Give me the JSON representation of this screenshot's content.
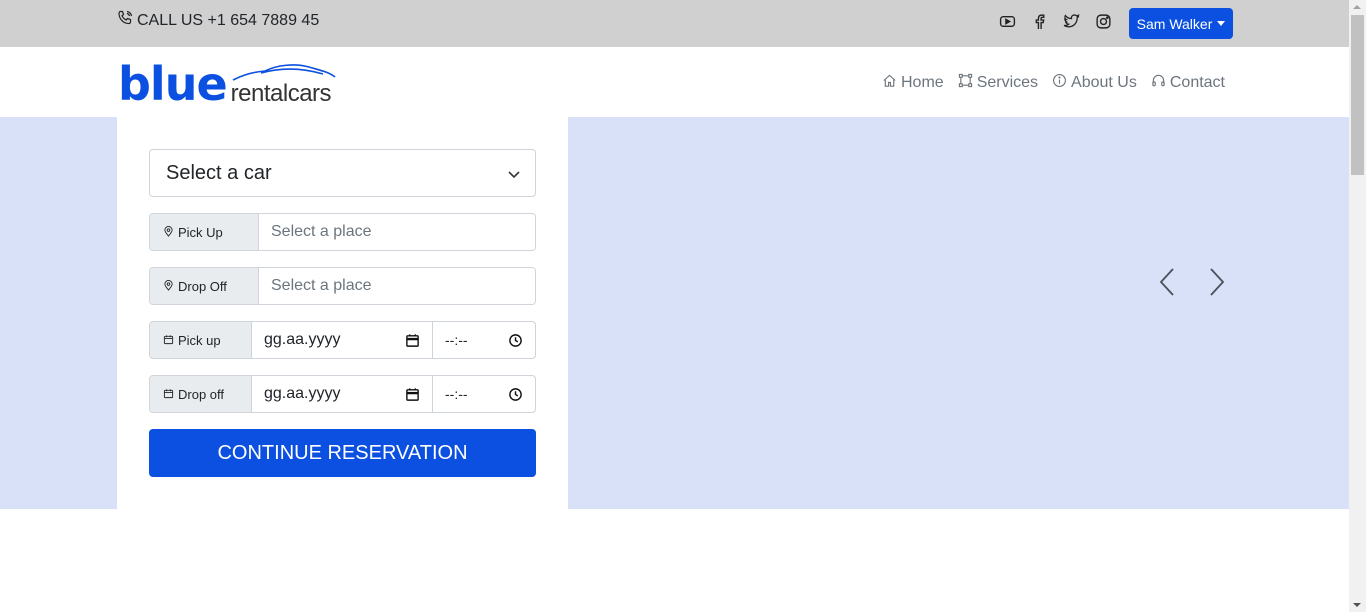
{
  "topbar": {
    "phone_text": "CALL US +1 654 7889 45",
    "social_icons": [
      "youtube-icon",
      "facebook-icon",
      "twitter-icon",
      "instagram-icon"
    ],
    "user_label": "Sam Walker"
  },
  "logo": {
    "main": "blue",
    "sub": "rentalcars"
  },
  "nav": {
    "items": [
      {
        "label": "Home",
        "icon": "home-icon"
      },
      {
        "label": "Services",
        "icon": "services-icon"
      },
      {
        "label": "About Us",
        "icon": "info-icon"
      },
      {
        "label": "Contact",
        "icon": "headphones-icon"
      }
    ]
  },
  "form": {
    "car_select": "Select a car",
    "pickup_place_label": "Pick Up",
    "pickup_place_placeholder": "Select a place",
    "dropoff_place_label": "Drop Off",
    "dropoff_place_placeholder": "Select a place",
    "pickup_date_label": "Pick up",
    "pickup_date_value": "gg.aa.yyyy",
    "pickup_time_value": "--:--",
    "dropoff_date_label": "Drop off",
    "dropoff_date_value": "gg.aa.yyyy",
    "dropoff_time_value": "--:--",
    "submit_label": "CONTINUE RESERVATION"
  },
  "colors": {
    "primary": "#0b50e0",
    "topbar_bg": "#d0d0d0",
    "hero_bg": "#d8e1f8"
  }
}
